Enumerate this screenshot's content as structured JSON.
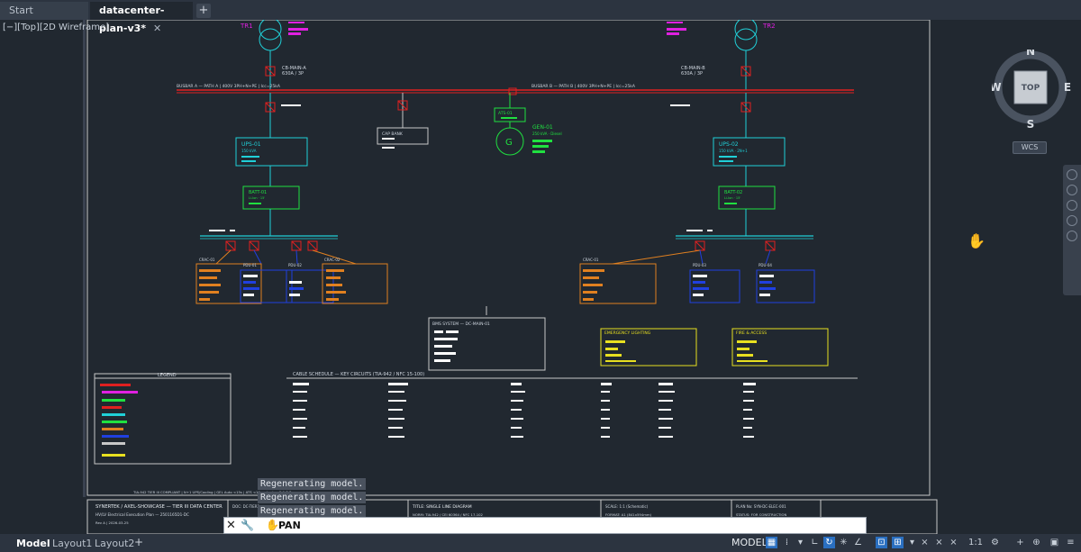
{
  "tabs": {
    "start": "Start",
    "active": "datacenter-plan-v3*",
    "close": "✕",
    "add": "+"
  },
  "viewport_label": "[−][Top][2D Wireframe]",
  "drawing": {
    "tr1": "TR1",
    "tr2": "TR2",
    "cb_main_a": "CB-MAIN-A",
    "cb_main_a_spec": "630A / 3P",
    "cb_main_b": "CB-MAIN-B",
    "cb_main_b_spec": "630A / 3P",
    "busbar_a": "BUSBAR A — PATH A  |  400V 3PH+N+PE  |  Icc=25kA",
    "busbar_b": "BUSBAR B — PATH B  |  400V 3PH+N+PE  |  Icc=25kA",
    "ats": "ATS-01",
    "cap_bank": "CAP BANK",
    "gen": "GEN-01",
    "gen_spec": "250 kVA · Diesel",
    "gen_symbol": "G",
    "ups1": "UPS-01",
    "ups1_spec": "150 kVA",
    "ups2": "UPS-02",
    "ups2_spec": "150 kVA · 2N+1",
    "batt1": "BATT-01",
    "batt1_spec": "Li-Ion · 15'",
    "batt2": "BATT-02",
    "batt2_spec": "Li-Ion · 15'",
    "crac_a1": "CRAC-01",
    "pdu_a1": "PDU-01",
    "pdu_a2": "PDU-02",
    "crac_a2": "CRAC-02",
    "crac_b1": "CRAC-01",
    "pdu_b3": "PDU-03",
    "pdu_b4": "PDU-04",
    "bms": "BMS SYSTEM — DC-MAIN-01",
    "emergency": "EMERGENCY LIGHTING",
    "fire": "FIRE & ACCESS",
    "legend": "LEGEND",
    "cable_schedule": "CABLE SCHEDULE — KEY CIRCUITS (TIA-942 / NFC 15-100)",
    "compliance": "TIA-942 TIER III COMPLIANT  |  N+1 UPS/Cooling  |  GEL Auto <15s  |  ATS <10ms  |  cctp-p2.1.3.S"
  },
  "title_block": {
    "company": "SYNERTEK  /  AXEL-SHOWCASE — TIER III DATA CENTER",
    "project": "HV/LV Electrical Execution Plan  —  2501165D1-DC",
    "rev": "Rev A  |  2026-03-25",
    "doc": "DOC: DC-TIER3",
    "sheet_title": "TITLE: SINGLE LINE DIAGRAM",
    "norms": "NORM: TIA-942 / CEI 60364 / NFC 17-102",
    "scale": "SCALE: 1:1 (Schematic)",
    "format": "FORMAT: A1 (841x594mm)",
    "plan_no": "PLAN No: SYN-DC-ELEC-001",
    "status": "STATUS: FOR CONSTRUCTION"
  },
  "command_history": [
    "Regenerating model.",
    "Regenerating model.",
    "Regenerating model."
  ],
  "command_input": "PAN",
  "viewcube": {
    "n": "N",
    "s": "S",
    "e": "E",
    "w": "W",
    "face": "TOP",
    "ucs": "WCS"
  },
  "layout_tabs": {
    "model": "Model",
    "layout1": "Layout1",
    "layout2": "Layout2",
    "add": "+"
  },
  "status": {
    "space": "MODEL",
    "scale": "1:1"
  },
  "colors": {
    "background": "#212830",
    "magenta": "#e020e0",
    "cyan": "#20d0d8",
    "green": "#20e040",
    "red": "#e02020",
    "orange": "#e08020",
    "blue": "#2040e0",
    "yellow": "#e8e020",
    "white": "#ffffff"
  }
}
